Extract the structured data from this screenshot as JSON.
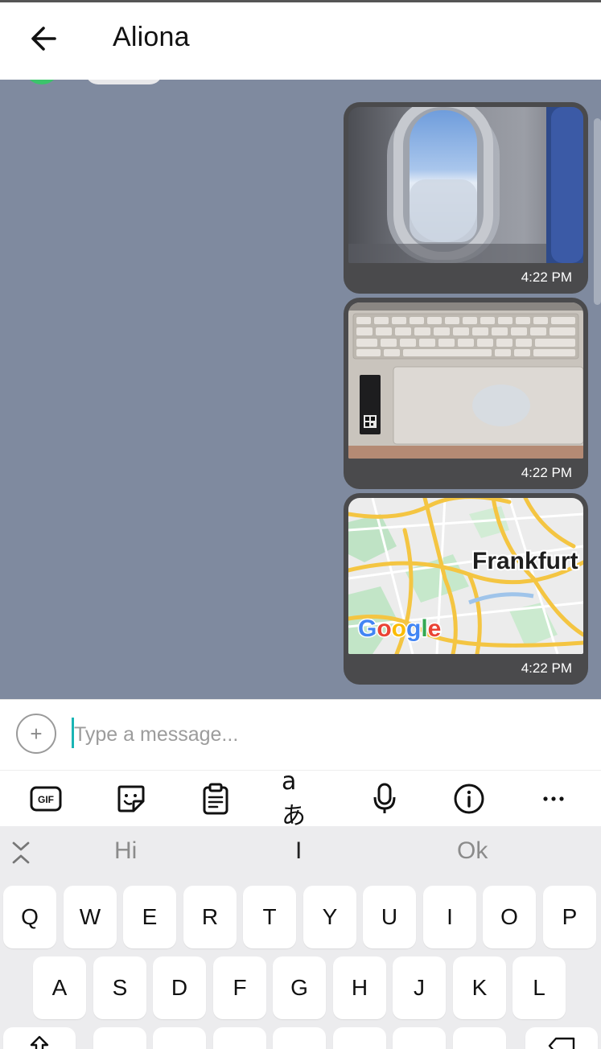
{
  "header": {
    "title": "Aliona"
  },
  "messages": [
    {
      "type": "image",
      "subject": "airplane-window",
      "time": "4:22 PM"
    },
    {
      "type": "image",
      "subject": "laptop-keyboard",
      "time": "4:22 PM"
    },
    {
      "type": "map",
      "label": "Frankfurt",
      "provider": "Google",
      "time": "4:22 PM"
    }
  ],
  "input": {
    "placeholder": "Type a message..."
  },
  "toolbar": {
    "gif_label": "GIF"
  },
  "suggestions": [
    "Hi",
    "I",
    "Ok"
  ],
  "keyboard": {
    "row1": [
      "Q",
      "W",
      "E",
      "R",
      "T",
      "Y",
      "U",
      "I",
      "O",
      "P"
    ],
    "row2": [
      "A",
      "S",
      "D",
      "F",
      "G",
      "H",
      "J",
      "K",
      "L"
    ]
  },
  "colors": {
    "chat_bg": "#7f8a9f",
    "bubble": "#4a4a4c",
    "caret": "#1ab5b5"
  }
}
